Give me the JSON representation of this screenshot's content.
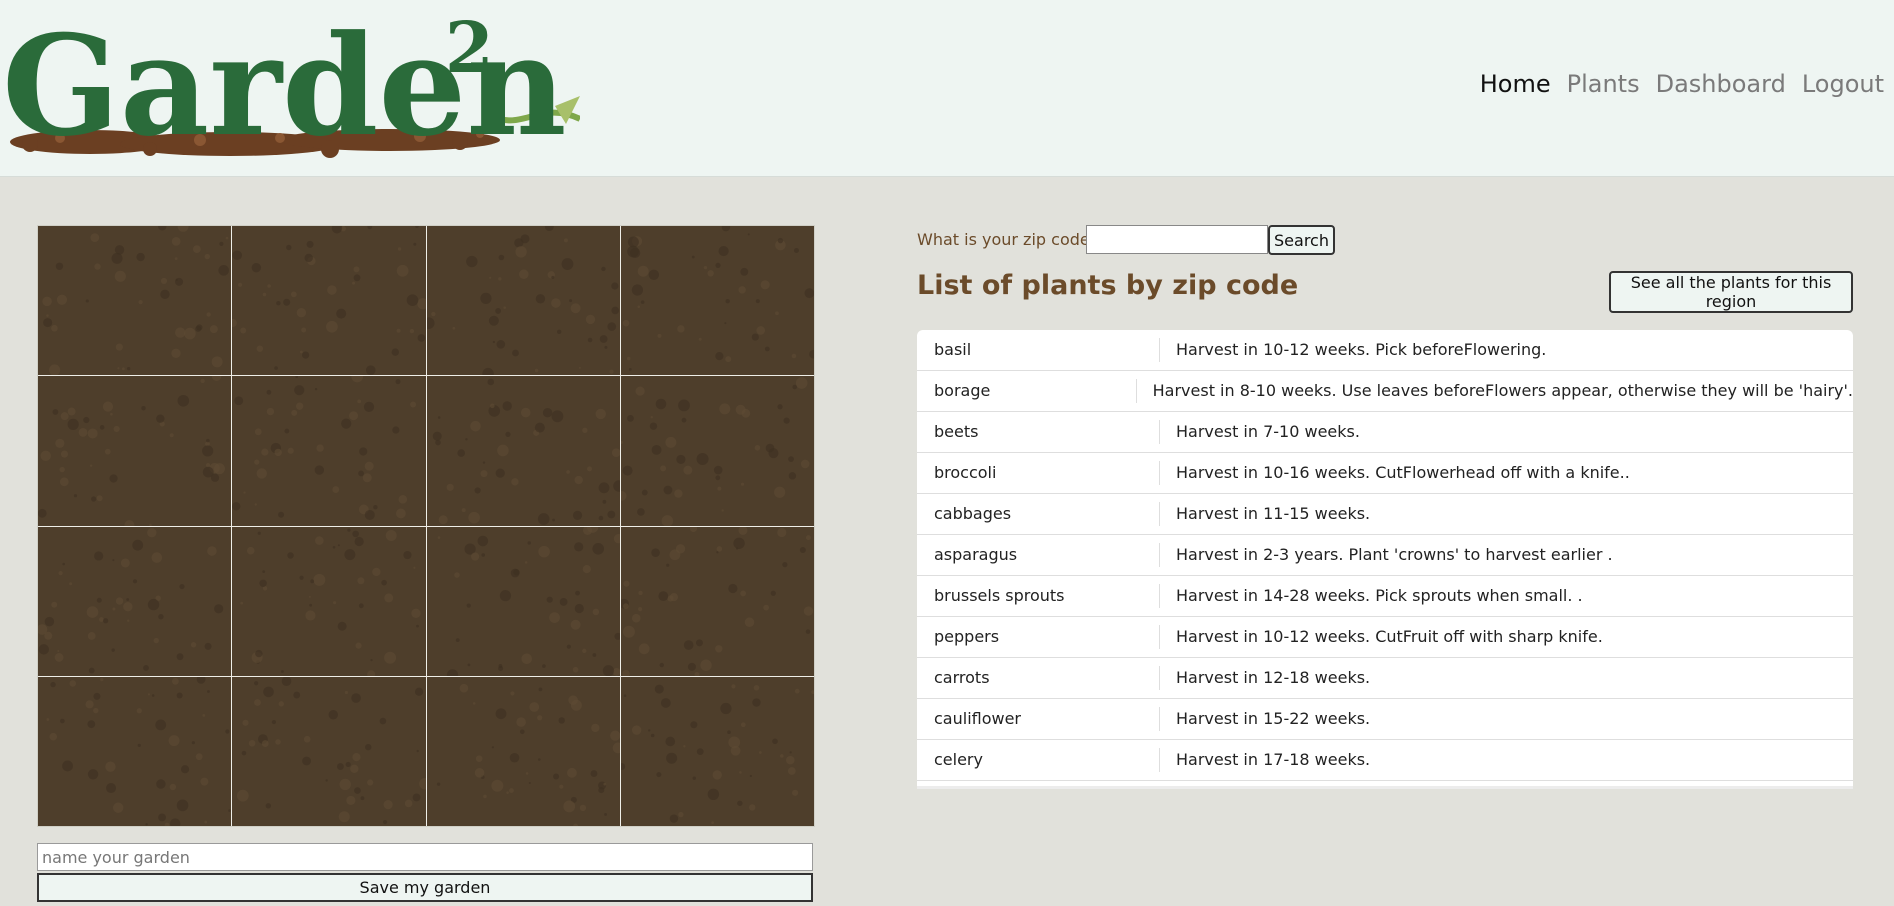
{
  "brand": {
    "logo_text": "Garden",
    "logo_superscript": "2"
  },
  "nav": {
    "items": [
      {
        "label": "Home",
        "active": true
      },
      {
        "label": "Plants",
        "active": false
      },
      {
        "label": "Dashboard",
        "active": false
      },
      {
        "label": "Logout",
        "active": false
      }
    ]
  },
  "garden": {
    "rows": 4,
    "cols": 4,
    "plot_texture": "soil",
    "name_placeholder": "name your garden",
    "name_value": "",
    "save_label": "Save my garden"
  },
  "zip_search": {
    "label": "What is your zip code?",
    "value": "",
    "search_label": "Search"
  },
  "plant_list": {
    "title": "List of plants by zip code",
    "see_all_label": "See all the plants for this region",
    "rows": [
      {
        "name": "basil",
        "desc": "Harvest in 10-12 weeks. Pick beforeFlowering."
      },
      {
        "name": "borage",
        "desc": "Harvest in 8-10 weeks. Use leaves beforeFlowers appear, otherwise they will be 'hairy'."
      },
      {
        "name": "beets",
        "desc": "Harvest in 7-10 weeks."
      },
      {
        "name": "broccoli",
        "desc": "Harvest in 10-16 weeks. CutFlowerhead off with a knife.."
      },
      {
        "name": "cabbages",
        "desc": "Harvest in 11-15 weeks."
      },
      {
        "name": "asparagus",
        "desc": "Harvest in 2-3 years. Plant 'crowns' to harvest earlier ."
      },
      {
        "name": "brussels sprouts",
        "desc": "Harvest in 14-28 weeks. Pick sprouts when small. ."
      },
      {
        "name": "peppers",
        "desc": "Harvest in 10-12 weeks. CutFruit off with sharp knife."
      },
      {
        "name": "carrots",
        "desc": "Harvest in 12-18 weeks."
      },
      {
        "name": "cauliflower",
        "desc": "Harvest in 15-22 weeks."
      },
      {
        "name": "celery",
        "desc": "Harvest in 17-18 weeks."
      }
    ]
  },
  "colors": {
    "header_bg": "#eef5f2",
    "page_bg": "#e1e1db",
    "logo_green": "#2a6b3a",
    "title_brown": "#6b4b2a",
    "soil": "#4e3e2b"
  }
}
